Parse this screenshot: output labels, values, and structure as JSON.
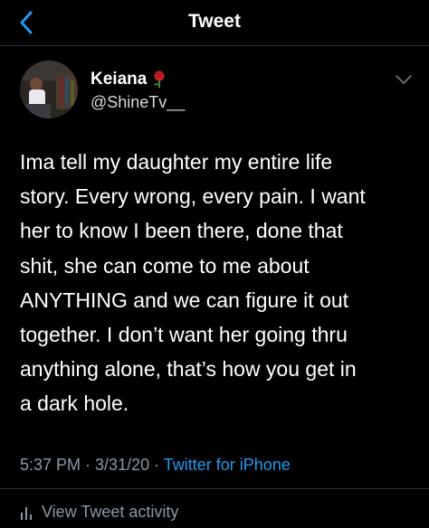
{
  "header": {
    "title": "Tweet",
    "back_icon": "chevron-left-icon"
  },
  "author": {
    "display_name": "Keiana",
    "badge_icon": "rose-emoji-icon",
    "handle": "@ShineTv__"
  },
  "tweet": {
    "text": "Ima tell my daughter my entire life\nstory. Every wrong, every pain. I want\nher to know I been there, done that\nshit, she can come to me about\nANYTHING and we can figure it out\ntogether. I don’t want her going thru\nanything alone, that’s how you get in\na dark hole.",
    "time": "5:37 PM",
    "date": "3/31/20",
    "source": "Twitter for iPhone",
    "separator": " · "
  },
  "footer": {
    "activity_label": "View Tweet activity",
    "activity_icon": "bar-chart-icon"
  },
  "colors": {
    "background": "#000000",
    "accent": "#1d9bf0",
    "secondary_text": "#8b98a5",
    "divider": "#2f3336"
  }
}
